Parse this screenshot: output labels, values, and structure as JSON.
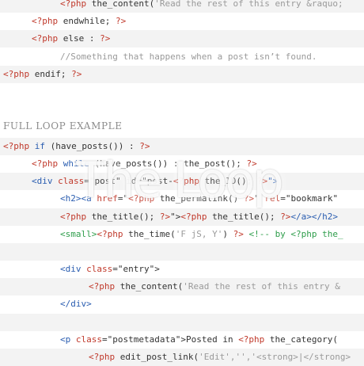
{
  "code_top": [
    {
      "tokens": [
        {
          "t": "<?php",
          "c": "php"
        },
        {
          "t": " the_content(",
          "c": ""
        },
        {
          "t": "'Read the rest of this entry &raquo;",
          "c": "str"
        }
      ]
    },
    {
      "tokens": [
        {
          "t": "<?php",
          "c": "php"
        },
        {
          "t": " endwhile; ",
          "c": ""
        },
        {
          "t": "?>",
          "c": "php"
        }
      ]
    },
    {
      "tokens": [
        {
          "t": "<?php",
          "c": "php"
        },
        {
          "t": " else : ",
          "c": ""
        },
        {
          "t": "?>",
          "c": "php"
        }
      ]
    },
    {
      "tokens": [
        {
          "t": "//Something that happens when a post isn’t found.",
          "c": "cm"
        }
      ]
    },
    {
      "tokens": [
        {
          "t": "<?php",
          "c": "php"
        },
        {
          "t": " endif; ",
          "c": ""
        },
        {
          "t": "?>",
          "c": "php"
        }
      ]
    }
  ],
  "section_title": "FULL LOOP EXAMPLE",
  "code_full": [
    {
      "tokens": [
        {
          "t": "<?php",
          "c": "php"
        },
        {
          "t": " if ",
          "c": "kw"
        },
        {
          "t": "(have_posts()) : ",
          "c": ""
        },
        {
          "t": "?>",
          "c": "php"
        }
      ]
    },
    {
      "tokens": [
        {
          "t": "<?php",
          "c": "php"
        },
        {
          "t": " while ",
          "c": "kw"
        },
        {
          "t": "(have_posts()) : the_post(); ",
          "c": ""
        },
        {
          "t": "?>",
          "c": "php"
        }
      ]
    },
    {
      "tokens": [
        {
          "t": "<div ",
          "c": "tag"
        },
        {
          "t": "class",
          "c": "php"
        },
        {
          "t": "=\"post\" id=\"post-",
          "c": ""
        },
        {
          "t": "<?php",
          "c": "php"
        },
        {
          "t": " the_ID(); ",
          "c": ""
        },
        {
          "t": "?>",
          "c": "php"
        },
        {
          "t": "\">",
          "c": "tag"
        }
      ]
    },
    {
      "tokens": [
        {
          "t": "<h2>",
          "c": "tag"
        },
        {
          "t": "<a ",
          "c": "tag"
        },
        {
          "t": "href",
          "c": "php"
        },
        {
          "t": "=\"",
          "c": ""
        },
        {
          "t": "<?php",
          "c": "php"
        },
        {
          "t": " the_permalink() ",
          "c": ""
        },
        {
          "t": "?>",
          "c": "php"
        },
        {
          "t": "\" ",
          "c": ""
        },
        {
          "t": "rel",
          "c": "php"
        },
        {
          "t": "=\"bookmark\" ",
          "c": ""
        }
      ]
    },
    {
      "tokens": [
        {
          "t": "<?php",
          "c": "php"
        },
        {
          "t": " the_title(); ",
          "c": ""
        },
        {
          "t": "?>",
          "c": "php"
        },
        {
          "t": "\">",
          "c": ""
        },
        {
          "t": "<?php",
          "c": "php"
        },
        {
          "t": " the_title(); ",
          "c": ""
        },
        {
          "t": "?>",
          "c": "php"
        },
        {
          "t": "</a></h2>",
          "c": "tag"
        }
      ]
    },
    {
      "tokens": [
        {
          "t": "<small>",
          "c": "grn"
        },
        {
          "t": "<?php",
          "c": "php"
        },
        {
          "t": " the_time(",
          "c": ""
        },
        {
          "t": "'F jS, Y'",
          "c": "str"
        },
        {
          "t": ") ",
          "c": ""
        },
        {
          "t": "?>",
          "c": "php"
        },
        {
          "t": " <!-- by <?php the_",
          "c": "grn"
        }
      ]
    },
    {
      "tokens": []
    },
    {
      "tokens": [
        {
          "t": "<div ",
          "c": "tag"
        },
        {
          "t": "class",
          "c": "php"
        },
        {
          "t": "=\"entry\">",
          "c": ""
        }
      ]
    },
    {
      "tokens": [
        {
          "t": "<?php",
          "c": "php"
        },
        {
          "t": " the_content(",
          "c": ""
        },
        {
          "t": "'Read the rest of this entry &",
          "c": "str"
        }
      ]
    },
    {
      "tokens": [
        {
          "t": "</div>",
          "c": "tag"
        }
      ]
    },
    {
      "tokens": []
    },
    {
      "tokens": [
        {
          "t": "<p ",
          "c": "tag"
        },
        {
          "t": "class",
          "c": "php"
        },
        {
          "t": "=\"postmetadata\">Posted in ",
          "c": ""
        },
        {
          "t": "<?php",
          "c": "php"
        },
        {
          "t": " the_category(",
          "c": ""
        }
      ]
    },
    {
      "tokens": [
        {
          "t": "<?php",
          "c": "php"
        },
        {
          "t": " edit_post_link(",
          "c": ""
        },
        {
          "t": "'Edit','','<strong>|</strong>",
          "c": "str"
        }
      ]
    }
  ],
  "watermark_text": "The Loop",
  "colors": {
    "php": "#c0392b",
    "keyword": "#2a5db0",
    "string": "#9a9a9a",
    "html_small": "#2e9d4b",
    "shade": "#f3f3f3"
  }
}
